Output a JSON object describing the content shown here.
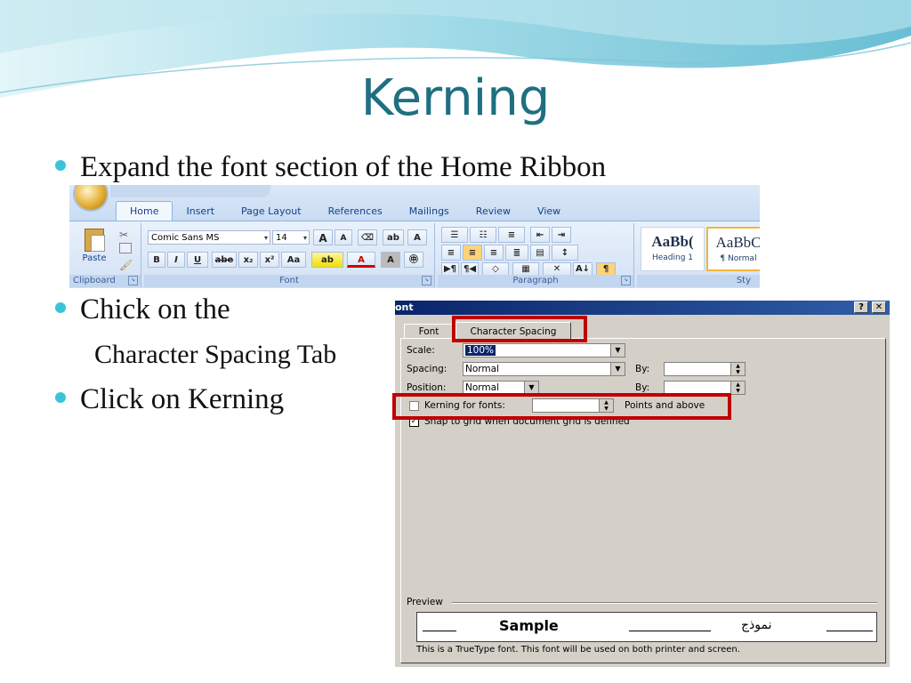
{
  "slide": {
    "title": "Kerning",
    "bullets": [
      "Expand the font section of the Home Ribbon",
      "Chick on the",
      "Click on Kerning"
    ],
    "sub_bullet": "Character Spacing Tab"
  },
  "ribbon": {
    "tabs": [
      "Home",
      "Insert",
      "Page Layout",
      "References",
      "Mailings",
      "Review",
      "View"
    ],
    "clipboard": {
      "paste_label": "Paste",
      "group_label": "Clipboard"
    },
    "font": {
      "font_name": "Comic Sans MS",
      "font_size": "14",
      "bold": "B",
      "italic": "I",
      "underline": "U",
      "strike": "abe",
      "subscript": "x₂",
      "superscript": "x²",
      "change_case": "Aa",
      "grow": "A",
      "shrink": "A",
      "group_label": "Font"
    },
    "paragraph": {
      "group_label": "Paragraph"
    },
    "styles": {
      "cards": [
        {
          "preview": "AaBb(",
          "name": "Heading 1"
        },
        {
          "preview": "AaBbC",
          "name": "¶ Normal"
        }
      ],
      "group_label": "Sty"
    }
  },
  "dialog": {
    "title": "ont",
    "help": "?",
    "close": "✕",
    "tabs": [
      "Font",
      "Character Spacing"
    ],
    "scale": {
      "label": "Scale:",
      "value": "100%"
    },
    "spacing": {
      "label": "Spacing:",
      "value": "Normal",
      "by_label": "By:"
    },
    "position": {
      "label": "Position:",
      "value": "Normal",
      "by_label": "By:"
    },
    "kerning": {
      "label": "Kerning for fonts:",
      "suffix": "Points and above",
      "checked": false
    },
    "snap": {
      "label": "Snap to grid when document grid is defined",
      "checked": true
    },
    "preview": {
      "label": "Preview",
      "sample": "Sample",
      "arabic_sample": "نموذج",
      "note": "This is a TrueType font. This font will be used on both printer and screen."
    }
  },
  "colors": {
    "title": "#1f6f82",
    "bullet_dot": "#3cc3d8",
    "highlight": "#c00000",
    "dialog_bg": "#d4d0c8"
  }
}
